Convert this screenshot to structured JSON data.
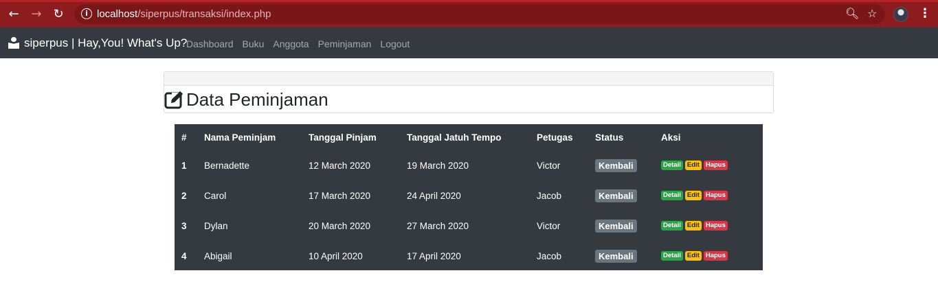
{
  "browser": {
    "url_host": "localhost",
    "url_path": "/siperpus/transaksi/index.php"
  },
  "navbar": {
    "brand": "siperpus | Hay,You! What's Up?",
    "menu": [
      "Dashboard",
      "Buku",
      "Anggota",
      "Peminjaman",
      "Logout"
    ]
  },
  "page": {
    "title": "Data Peminjaman"
  },
  "table": {
    "headers": [
      "#",
      "Nama Peminjam",
      "Tanggal Pinjam",
      "Tanggal Jatuh Tempo",
      "Petugas",
      "Status",
      "Aksi"
    ],
    "rows": [
      {
        "no": "1",
        "nama": "Bernadette",
        "pinjam": "12 March 2020",
        "tempo": "19 March 2020",
        "petugas": "Victor",
        "status": "Kembali"
      },
      {
        "no": "2",
        "nama": "Carol",
        "pinjam": "17 March 2020",
        "tempo": "24 April 2020",
        "petugas": "Jacob",
        "status": "Kembali"
      },
      {
        "no": "3",
        "nama": "Dylan",
        "pinjam": "20 March 2020",
        "tempo": "27 March 2020",
        "petugas": "Victor",
        "status": "Kembali"
      },
      {
        "no": "4",
        "nama": "Abigail",
        "pinjam": "10 April 2020",
        "tempo": "17 April 2020",
        "petugas": "Jacob",
        "status": "Kembali"
      }
    ],
    "actions": {
      "detail": "Detail",
      "edit": "Edit",
      "hapus": "Hapus"
    }
  },
  "colors": {
    "browser_bar": "#8d1c1f",
    "navbar": "#343a40",
    "detail": "#28a745",
    "edit": "#ffc107",
    "hapus": "#dc3545",
    "status": "#6c757d"
  }
}
